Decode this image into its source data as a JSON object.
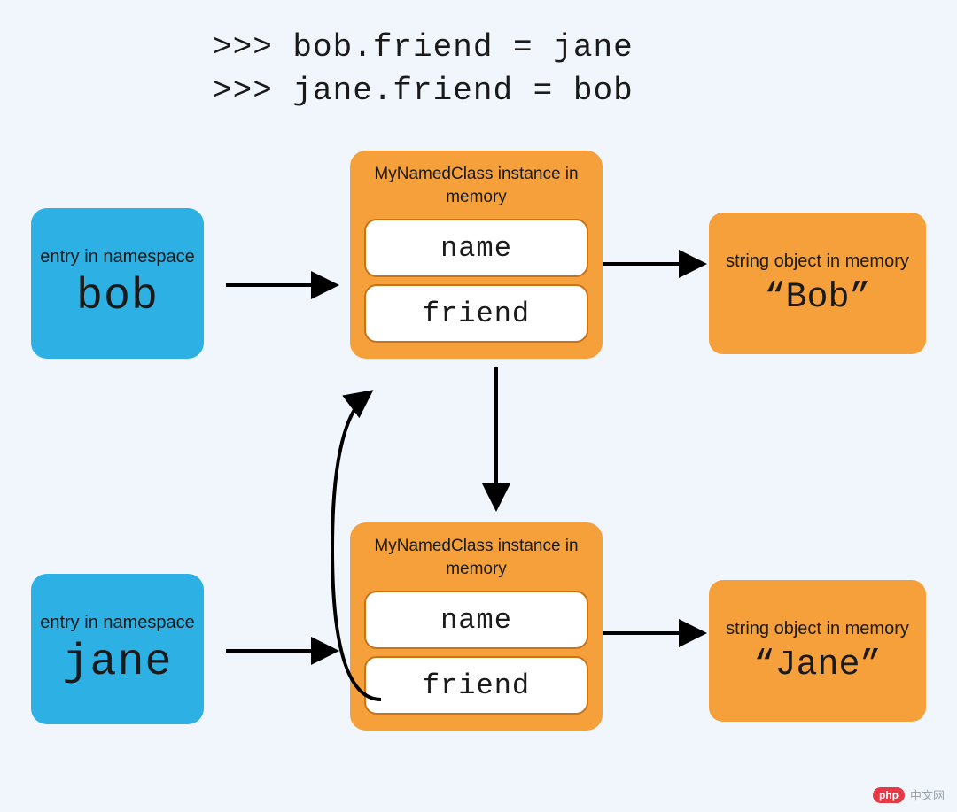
{
  "code": {
    "line1": ">>> bob.friend = jane",
    "line2": ">>> jane.friend = bob"
  },
  "namespace_label": "entry in namespace",
  "instance_label": "MyNamedClass instance in memory",
  "string_label": "string object in memory",
  "attr_name": "name",
  "attr_friend": "friend",
  "bob": {
    "var": "bob",
    "value": "“Bob”"
  },
  "jane": {
    "var": "jane",
    "value": "“Jane”"
  },
  "watermark": {
    "badge": "php",
    "text": "中文网"
  },
  "chart_data": {
    "type": "diagram",
    "title": "Circular reference between two Python objects",
    "nodes": [
      {
        "id": "ns_bob",
        "kind": "namespace-entry",
        "label": "bob"
      },
      {
        "id": "ns_jane",
        "kind": "namespace-entry",
        "label": "jane"
      },
      {
        "id": "inst_bob",
        "kind": "instance",
        "class": "MyNamedClass",
        "attributes": [
          "name",
          "friend"
        ]
      },
      {
        "id": "inst_jane",
        "kind": "instance",
        "class": "MyNamedClass",
        "attributes": [
          "name",
          "friend"
        ]
      },
      {
        "id": "str_bob",
        "kind": "string",
        "value": "Bob"
      },
      {
        "id": "str_jane",
        "kind": "string",
        "value": "Jane"
      }
    ],
    "edges": [
      {
        "from": "ns_bob",
        "to": "inst_bob"
      },
      {
        "from": "ns_jane",
        "to": "inst_jane"
      },
      {
        "from": "inst_bob",
        "attr": "name",
        "to": "str_bob"
      },
      {
        "from": "inst_jane",
        "attr": "name",
        "to": "str_jane"
      },
      {
        "from": "inst_bob",
        "attr": "friend",
        "to": "inst_jane"
      },
      {
        "from": "inst_jane",
        "attr": "friend",
        "to": "inst_bob"
      }
    ]
  }
}
